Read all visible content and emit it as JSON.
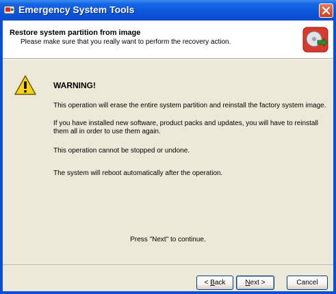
{
  "window": {
    "title": "Emergency System Tools",
    "title_icon": "app-icon",
    "close_icon": "close-icon"
  },
  "header": {
    "title": "Restore system partition from image",
    "subtitle": "Please make sure that you really want to perform the recovery action.",
    "icon": "disk-restore-icon"
  },
  "warning": {
    "icon": "warning-icon",
    "heading": "WARNING!",
    "paragraphs": [
      "This operation will erase the entire system partition and reinstall the factory system image.",
      "If you have installed new software, product packs and updates, you will have to reinstall them all in order to use them again.",
      "This operation cannot be stopped or undone.",
      "The system will reboot automatically after the operation."
    ]
  },
  "prompt": "Press \"Next\" to continue.",
  "buttons": {
    "back": {
      "prefix": "< ",
      "mnemonic": "B",
      "rest": "ack"
    },
    "next": {
      "mnemonic": "N",
      "rest": "ext >"
    },
    "cancel": "Cancel"
  },
  "colors": {
    "titlebar": "#0a50d6",
    "dialog_bg": "#ece9d8",
    "header_bg": "#ffffff",
    "close_button": "#c8401c"
  }
}
